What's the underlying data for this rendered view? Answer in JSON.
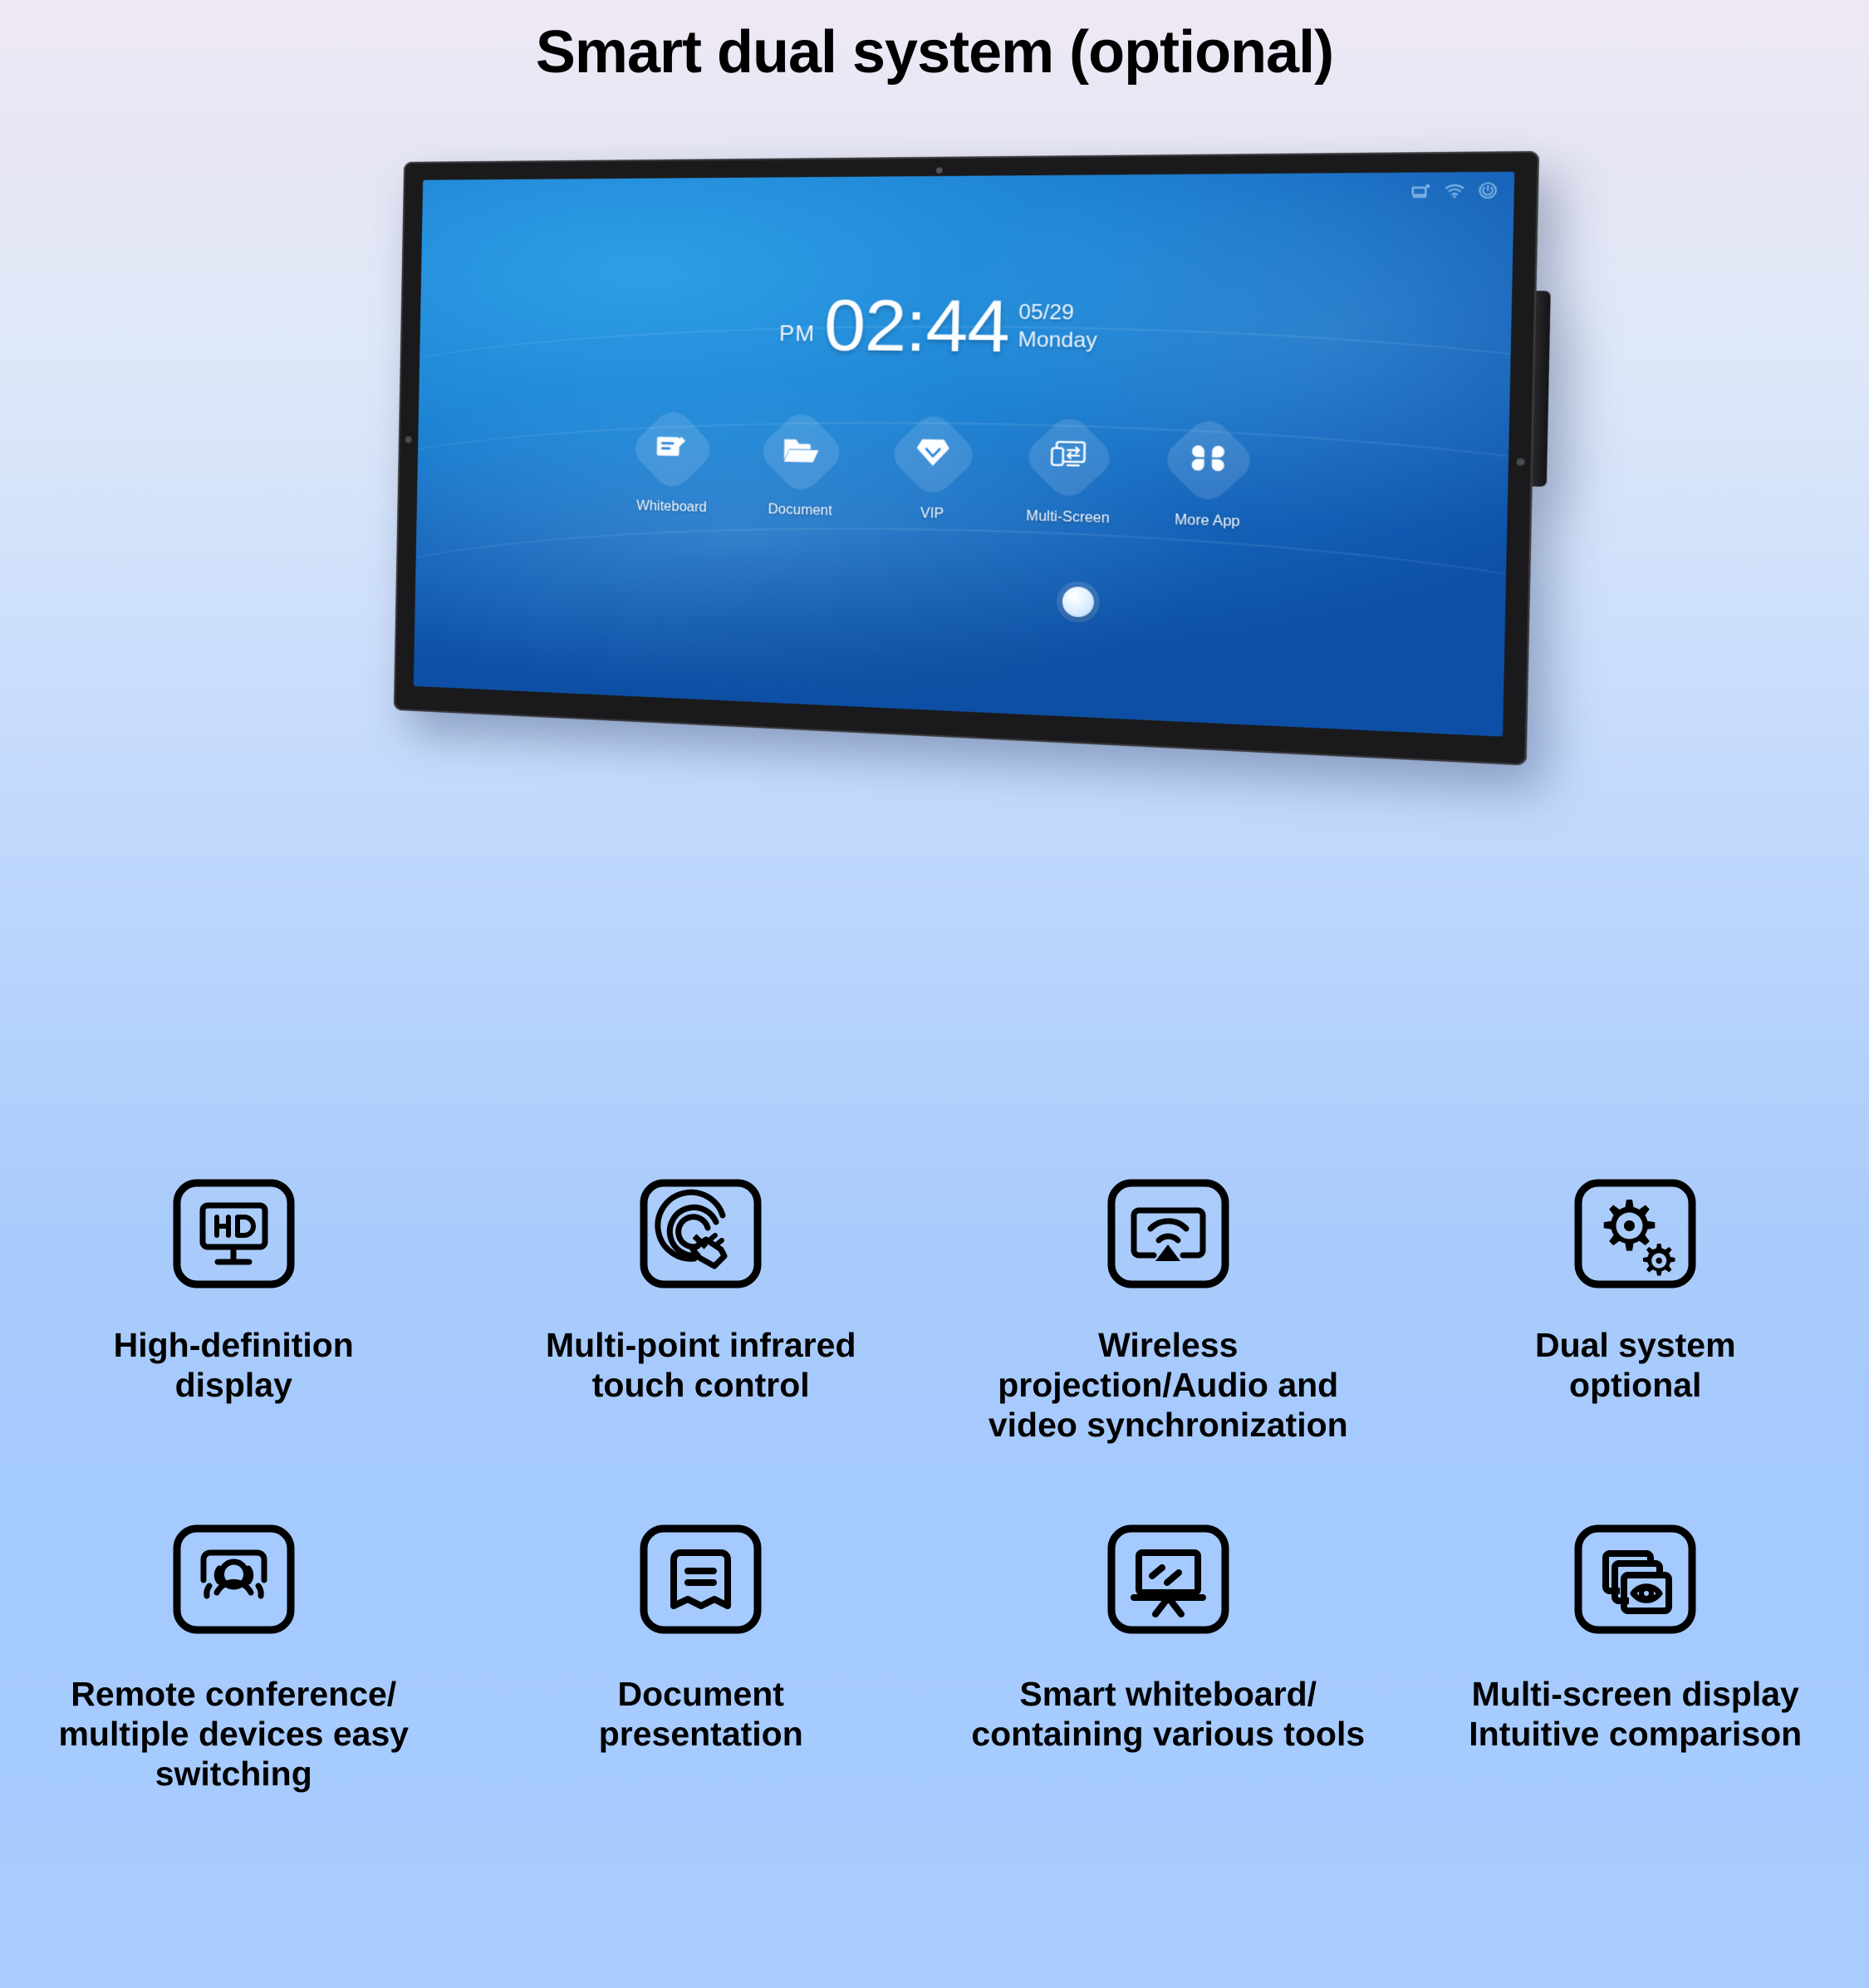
{
  "page": {
    "title": "Smart dual system (optional)",
    "background_top": "#efe8f4",
    "background_bottom": "#a9ccfe"
  },
  "device": {
    "brand_mark": "",
    "status_icons": [
      "cast-icon",
      "wifi-icon",
      "power-icon"
    ],
    "screen": {
      "clock": {
        "ampm": "PM",
        "time": "02:44",
        "date": "05/29",
        "weekday": "Monday"
      },
      "dock_apps": [
        {
          "label": "Whiteboard",
          "icon": "whiteboard-icon"
        },
        {
          "label": "Document",
          "icon": "folder-icon"
        },
        {
          "label": "VIP",
          "icon": "diamond-icon"
        },
        {
          "label": "Multi-Screen",
          "icon": "multi-screen-icon"
        },
        {
          "label": "More App",
          "icon": "more-app-icon"
        }
      ],
      "home_button": "home-button"
    }
  },
  "features": {
    "row1": [
      {
        "icon": "hd-display-icon",
        "caption": "High-definition\ndisplay"
      },
      {
        "icon": "touch-gesture-icon",
        "caption": "Multi-point infrared\ntouch control"
      },
      {
        "icon": "wireless-cast-icon",
        "caption": "Wireless\nprojection/Audio and\nvideo synchronization"
      },
      {
        "icon": "gears-icon",
        "caption": "Dual system\noptional"
      }
    ],
    "row2": [
      {
        "icon": "conference-people-icon",
        "caption": "Remote conference/\nmultiple devices easy\nswitching"
      },
      {
        "icon": "document-icon",
        "caption": "Document\npresentation"
      },
      {
        "icon": "whiteboard-easel-icon",
        "caption": "Smart whiteboard/\ncontaining various tools"
      },
      {
        "icon": "multi-screen-eye-icon",
        "caption": "Multi-screen display\nIntuitive comparison"
      }
    ]
  }
}
